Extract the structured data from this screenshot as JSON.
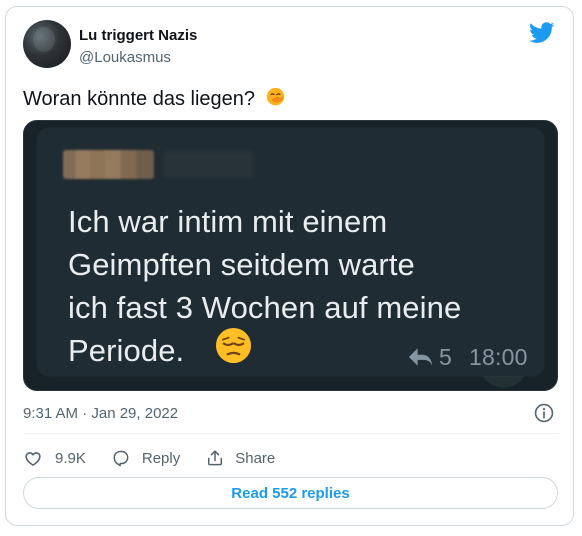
{
  "tweet": {
    "author": {
      "display_name": "Lu triggert Nazis",
      "handle": "@Loukasmus",
      "avatar_icon": "avatar-photo"
    },
    "brand_icon": "twitter-bird-icon",
    "text": "Woran könnte das liegen?",
    "text_emoji": "hand-over-mouth-emoji",
    "timestamp": "9:31 AM · Jan 29, 2022",
    "metrics": {
      "likes": "9.9K"
    },
    "actions": {
      "reply_label": "Reply",
      "share_label": "Share"
    },
    "read_replies_label": "Read 552 replies"
  },
  "media": {
    "message_text": "Ich war intim mit einem\nGeimpften seitdem warte\nich fast 3 Wochen auf meine\nPeriode.",
    "message_emoji": "pensive-face-emoji",
    "forward_count": "5",
    "time": "18:00",
    "forward_icon": "forward-arrow-icon"
  },
  "colors": {
    "twitter_blue": "#1d9bf0",
    "text_primary": "#0f1419",
    "text_secondary": "#536471",
    "chat_background": "#172328",
    "chat_bubble": "#202c33",
    "chat_text": "#e9edef"
  }
}
